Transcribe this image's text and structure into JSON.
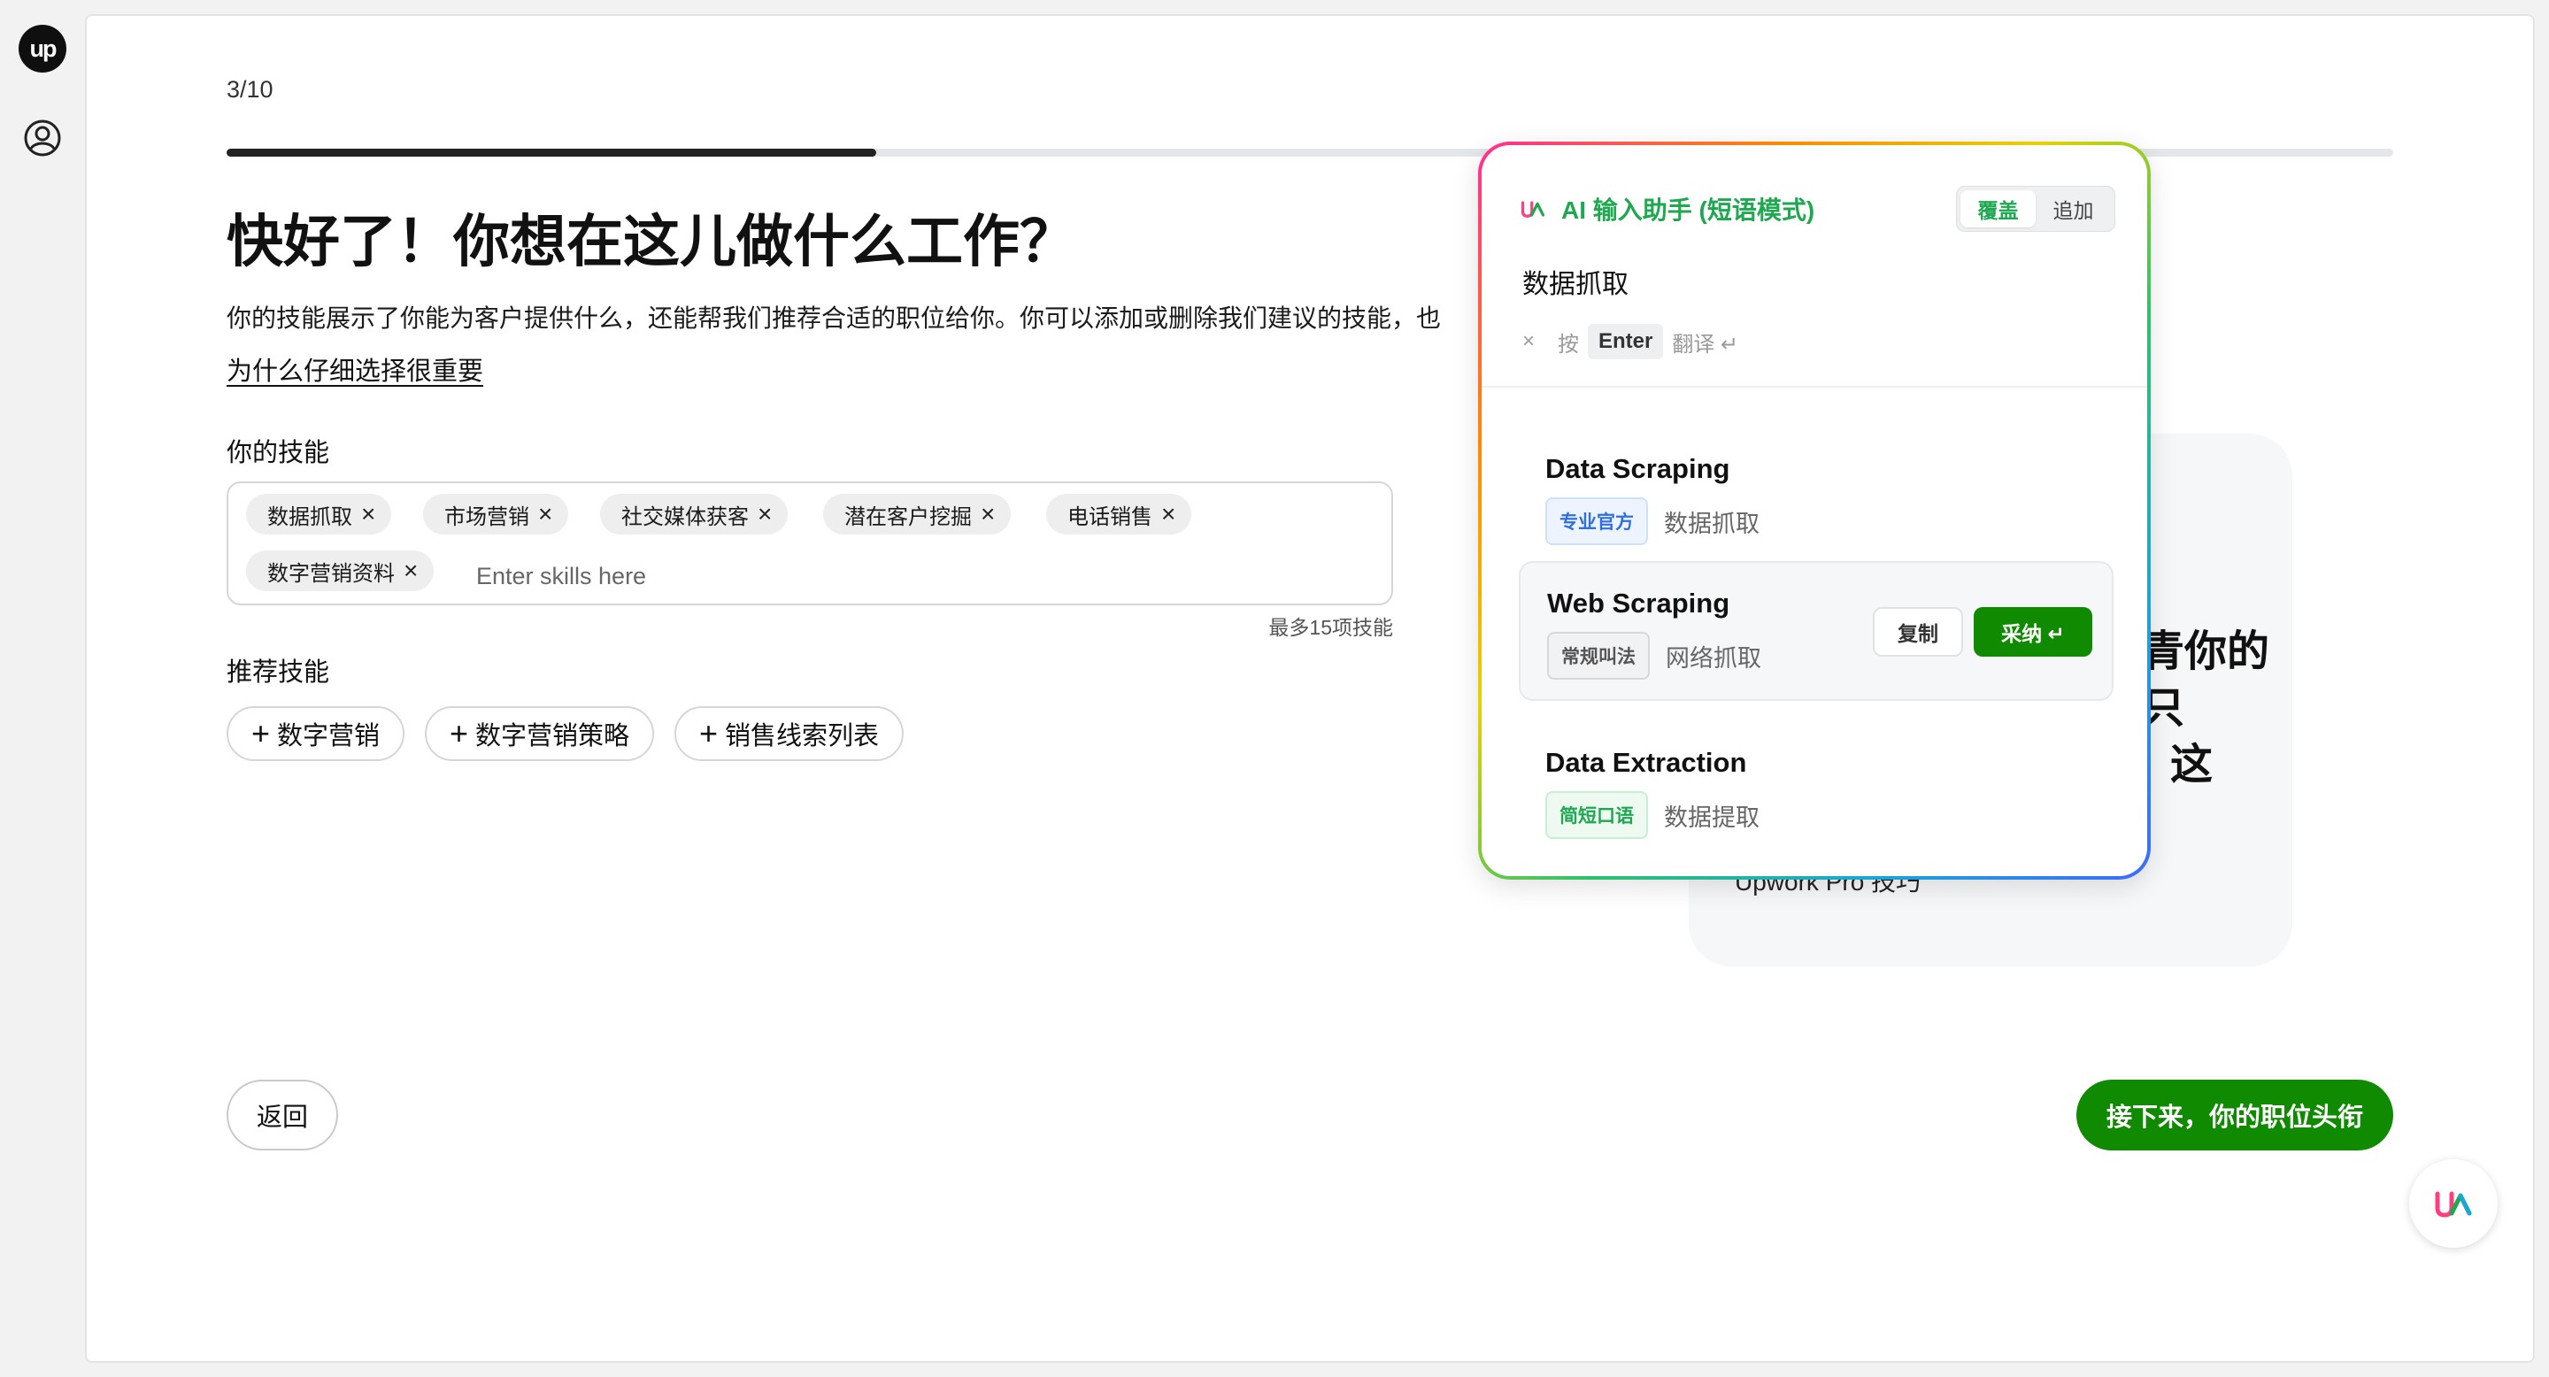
{
  "app": {
    "logo_text": "up"
  },
  "progress": {
    "step_text": "3/10",
    "fraction": 0.3
  },
  "page": {
    "title": "快好了！你想在这儿做什么工作？",
    "description": "你的技能展示了你能为客户提供什么，还能帮我们推荐合适的职位给你。你可以添加或删除我们建议的技能，也",
    "why_link": "为什么仔细选择很重要"
  },
  "skills": {
    "label": "你的技能",
    "chips": [
      "数据抓取",
      "市场营销",
      "社交媒体获客",
      "潜在客户挖掘",
      "电话销售",
      "数字营销资料"
    ],
    "input_placeholder": "Enter skills here",
    "limit_text": "最多15项技能"
  },
  "recommended": {
    "label": "推荐技能",
    "items": [
      "数字营销",
      "数字营销策略",
      "销售线索列表"
    ]
  },
  "buttons": {
    "back": "返回",
    "next": "接下来，你的职位头衔"
  },
  "tip": {
    "heading_lines": [
      "青你的",
      "只",
      "这"
    ],
    "footer": "Upwork Pro 技巧"
  },
  "ai_popup": {
    "title": "AI 输入助手 (短语模式)",
    "mode_options": [
      "覆盖",
      "追加"
    ],
    "active_mode": "覆盖",
    "query": "数据抓取",
    "hint": {
      "clear": "×",
      "press": "按",
      "key": "Enter",
      "action": "翻译 ↵"
    },
    "candidates": [
      {
        "en": "Data Scraping",
        "tag": "专业官方",
        "tag_color": "#2f6fe0",
        "zh": "数据抓取"
      },
      {
        "en": "Web Scraping",
        "tag": "常规叫法",
        "tag_color": "#555555",
        "zh": "网络抓取"
      },
      {
        "en": "Data Extraction",
        "tag": "简短口语",
        "tag_color": "#1ea84f",
        "zh": "数据提取"
      }
    ],
    "copy_label": "复制",
    "adopt_label": "采纳 ↵"
  },
  "colors": {
    "brand_green": "#108a00",
    "ai_green": "#1ea84f"
  }
}
